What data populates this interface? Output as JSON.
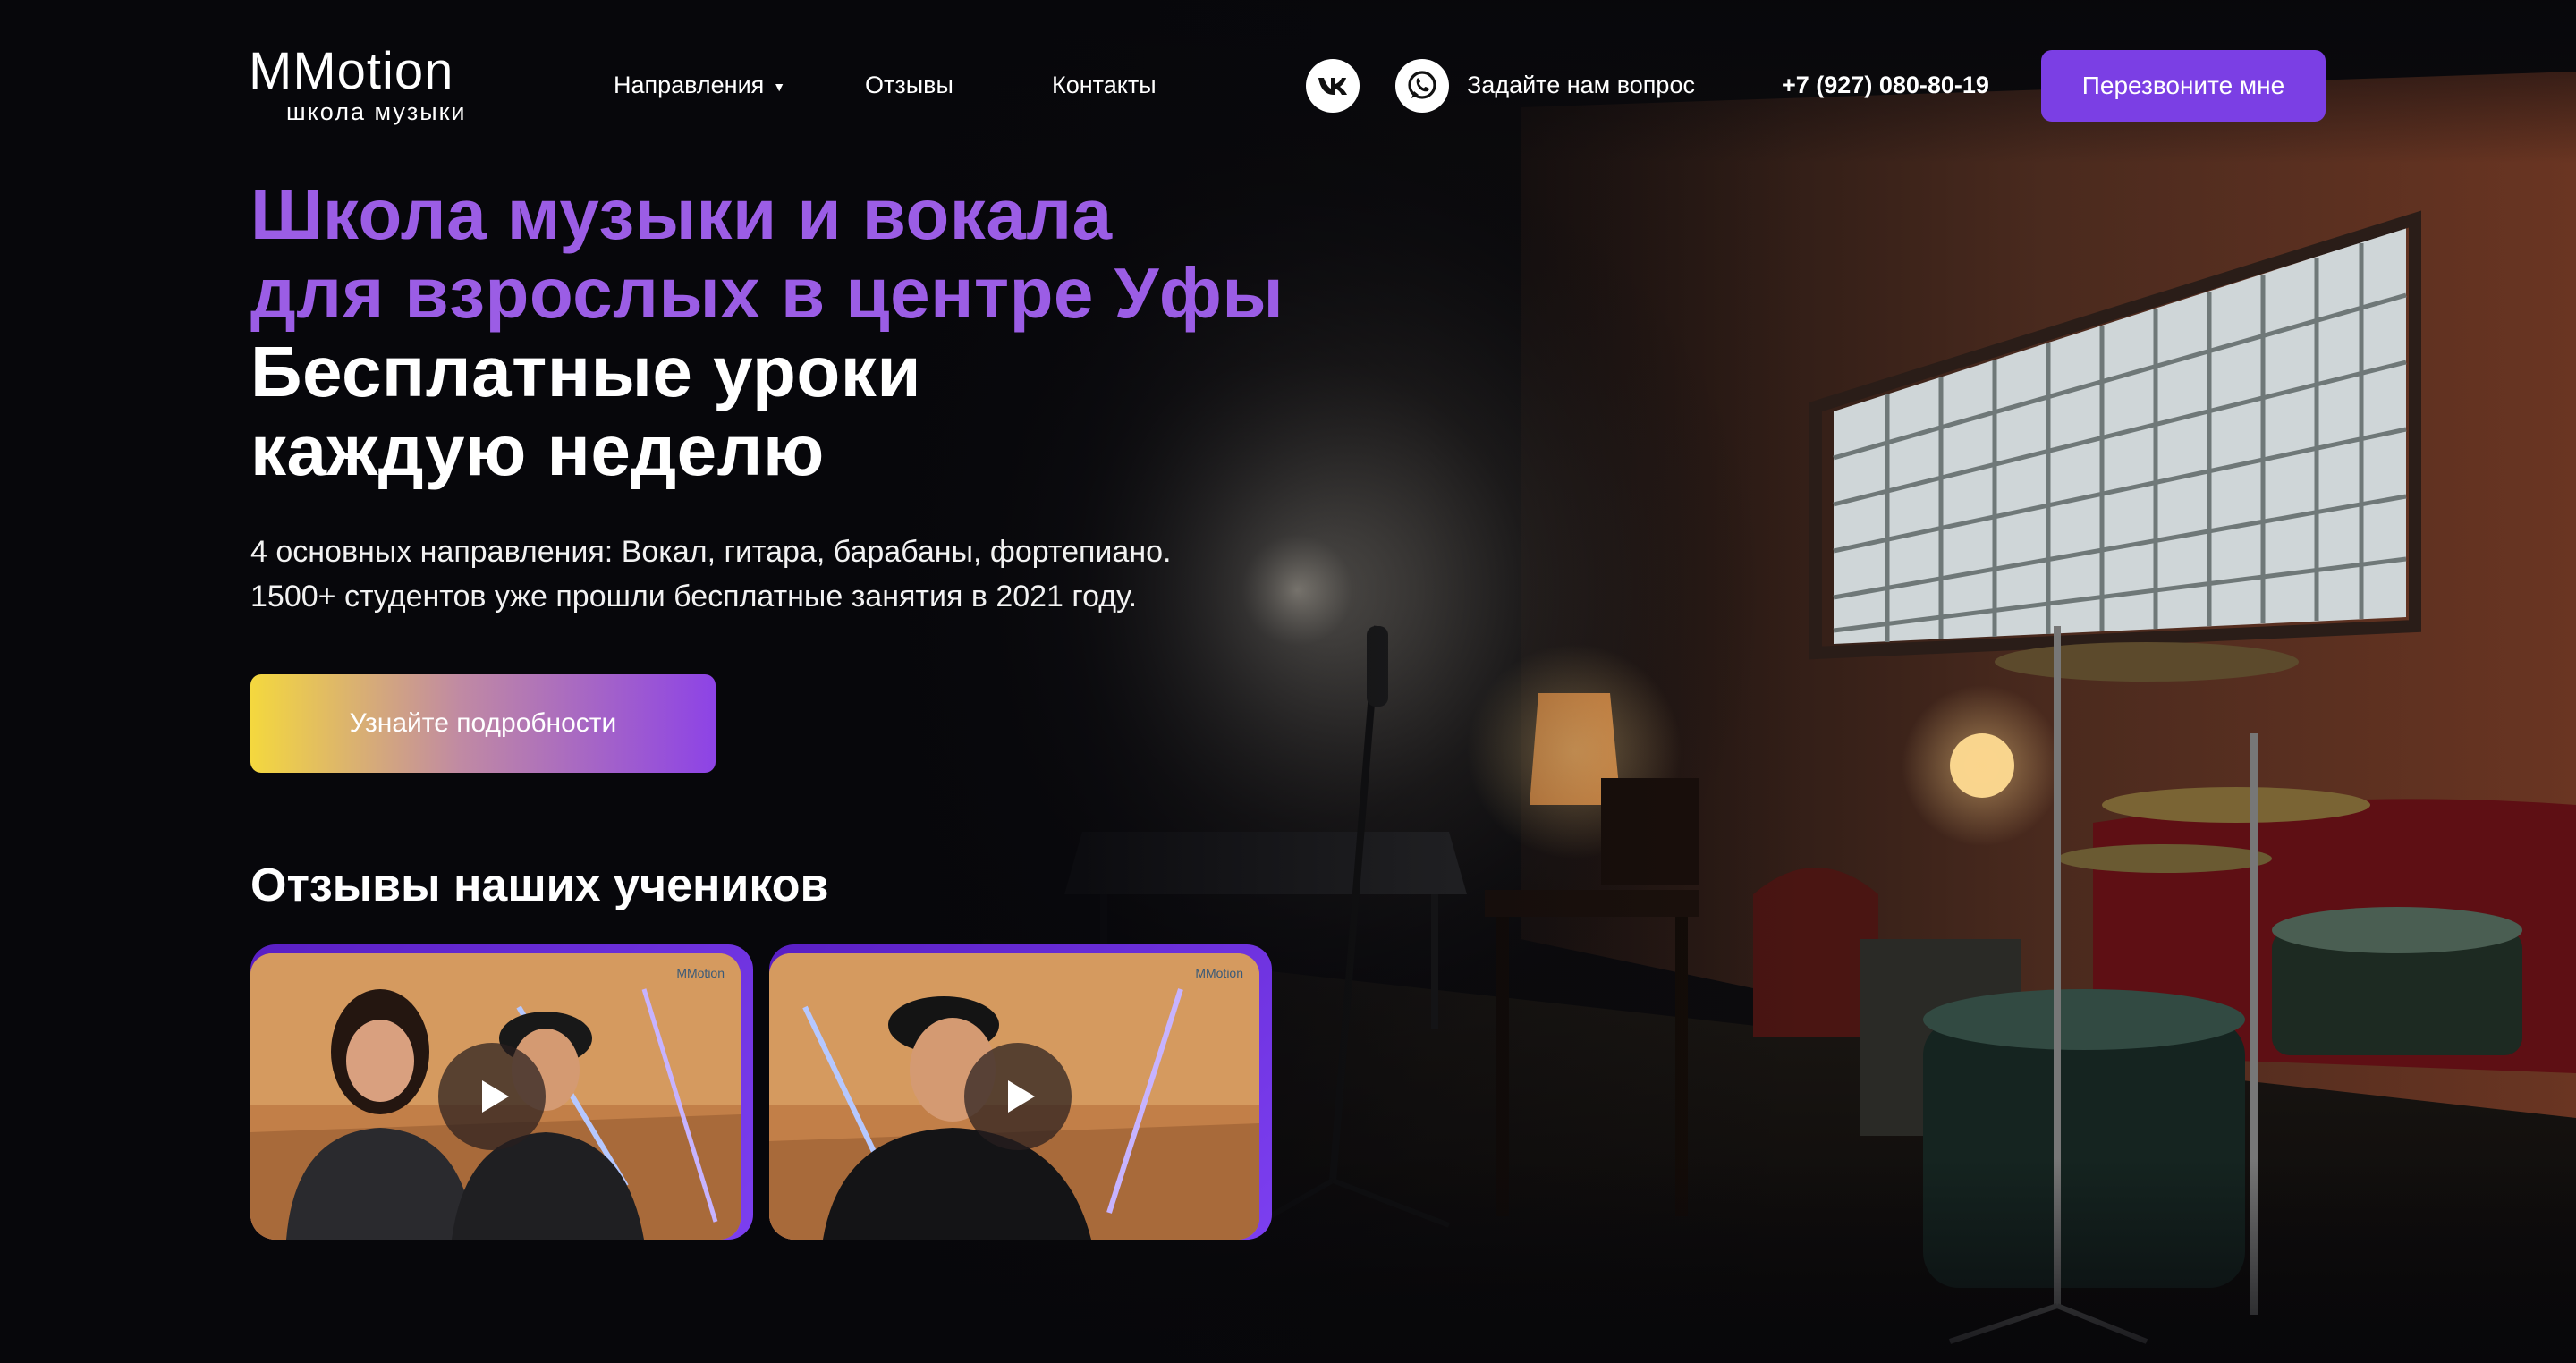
{
  "header": {
    "logo_title": "MMotion",
    "logo_subtitle": "школа музыки",
    "nav": [
      {
        "label": "Направления",
        "has_dropdown": true
      },
      {
        "label": "Отзывы"
      },
      {
        "label": "Контакты"
      }
    ],
    "social_icons": [
      "vk-icon",
      "whatsapp-icon"
    ],
    "ask_question": "Задайте нам вопрос",
    "phone": "+7 (927) 080-80-19",
    "callback_button": "Перезвоните мне"
  },
  "hero": {
    "title_purple_line1": "Школа музыки и вокала",
    "title_purple_line2": "для взрослых в центре Уфы",
    "title_white_line1": "Бесплатные уроки",
    "title_white_line2": "каждую неделю",
    "desc_line1": "4 основных направления: Вокал, гитара, барабаны, фортепиано.",
    "desc_line2": "1500+ студентов уже прошли бесплатные занятия в 2021 году.",
    "cta_button": "Узнайте подробности"
  },
  "reviews": {
    "title": "Отзывы наших учеников",
    "videos": [
      {
        "watermark": "MMotion",
        "icon": "play-icon"
      },
      {
        "watermark": "MMotion",
        "icon": "play-icon"
      }
    ]
  },
  "colors": {
    "accent": "#7b3fe4",
    "title_purple": "#9b5de5",
    "background": "#07070b",
    "cta_gradient_start": "#f4d83e",
    "cta_gradient_end": "#8d43e6"
  }
}
